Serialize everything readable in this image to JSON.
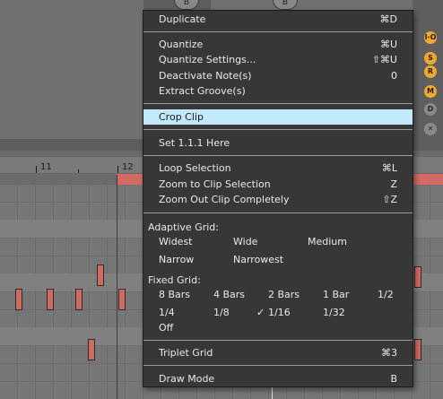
{
  "top_knobs": [
    "B",
    "B"
  ],
  "side_buttons": [
    {
      "label": "I·O",
      "color": "#f0a830"
    },
    {
      "label": "S",
      "color": "#f0a830"
    },
    {
      "label": "R",
      "color": "#f0a830"
    },
    {
      "label": "M",
      "color": "#f0a830"
    },
    {
      "label": "D",
      "color": "#8a8a8a"
    },
    {
      "label": "✕",
      "color": "#8a8a8a"
    }
  ],
  "ruler": {
    "labels": [
      "11",
      "12"
    ]
  },
  "menu": {
    "items": {
      "duplicate": {
        "label": "Duplicate",
        "shortcut": "⌘D"
      },
      "quantize": {
        "label": "Quantize",
        "shortcut": "⌘U"
      },
      "quantize_settings": {
        "label": "Quantize Settings...",
        "shortcut": "⇧⌘U"
      },
      "deactivate_notes": {
        "label": "Deactivate Note(s)",
        "shortcut": "0"
      },
      "extract_grooves": {
        "label": "Extract Groove(s)",
        "shortcut": ""
      },
      "crop_clip": {
        "label": "Crop Clip",
        "shortcut": ""
      },
      "set_here": {
        "label": "Set 1.1.1 Here",
        "shortcut": ""
      },
      "loop_selection": {
        "label": "Loop Selection",
        "shortcut": "⌘L"
      },
      "zoom_clip_selection": {
        "label": "Zoom to Clip Selection",
        "shortcut": "Z"
      },
      "zoom_out_clip": {
        "label": "Zoom Out Clip Completely",
        "shortcut": "⇧Z"
      },
      "triplet_grid": {
        "label": "Triplet Grid",
        "shortcut": "⌘3"
      },
      "draw_mode": {
        "label": "Draw Mode",
        "shortcut": "B"
      }
    },
    "adaptive_grid": {
      "header": "Adaptive Grid:",
      "options": [
        "Widest",
        "Wide",
        "Medium",
        "Narrow",
        "Narrowest"
      ]
    },
    "fixed_grid": {
      "header": "Fixed Grid:",
      "options": [
        "8 Bars",
        "4 Bars",
        "2 Bars",
        "1 Bar",
        "1/2",
        "1/4",
        "1/8",
        "1/16",
        "1/32",
        "Off"
      ],
      "selected": "1/16",
      "check_mark": "✓"
    }
  }
}
